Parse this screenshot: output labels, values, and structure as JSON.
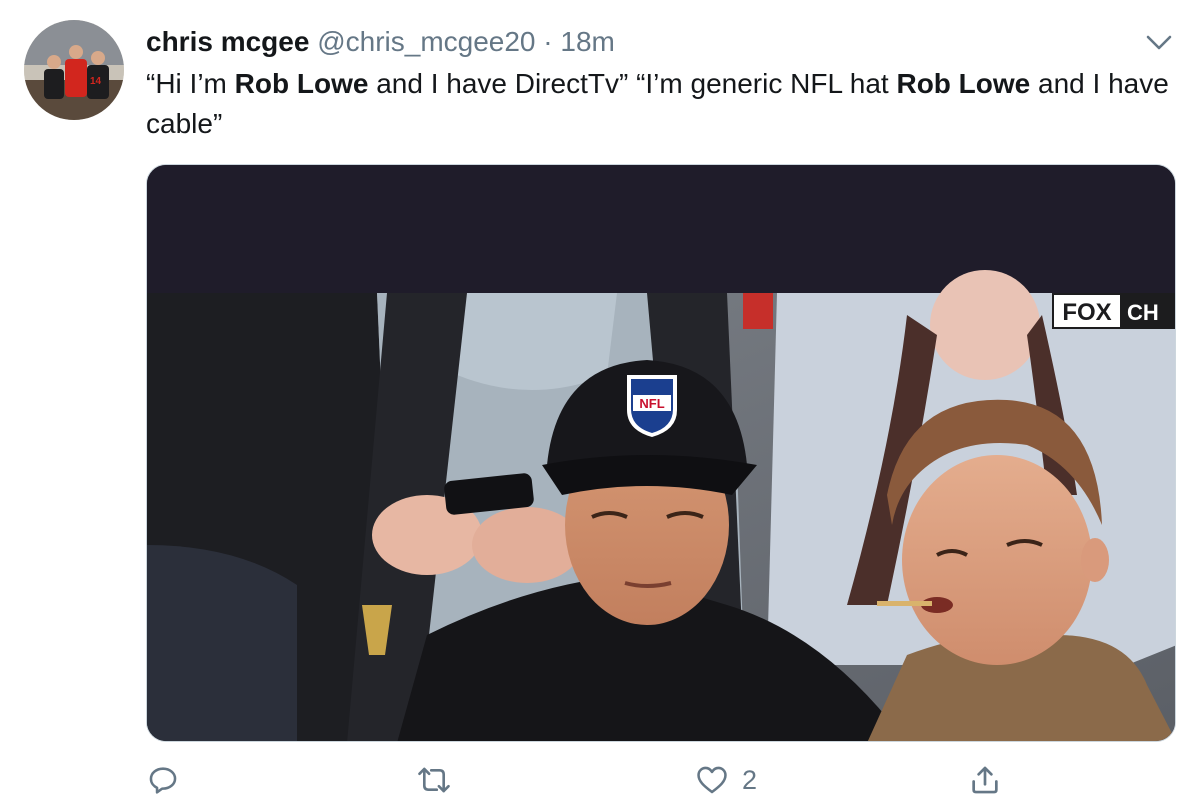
{
  "tweet": {
    "display_name": "chris mcgee",
    "handle": "@chris_mcgee20",
    "separator": "·",
    "time": "18m",
    "text": {
      "p1": "“Hi I’m ",
      "b1": "Rob Lowe",
      "p2": " and I have DirectTv” “I’m generic NFL hat ",
      "b2": "Rob Lowe",
      "p3": " and I have cable”"
    },
    "media": {
      "broadcast_logo": "FOX",
      "broadcast_ticker": "CH",
      "hat_logo_text": "NFL"
    },
    "actions": {
      "like_count": "2"
    }
  },
  "icons": {
    "avatar": "avatar",
    "caret": "chevron-down-icon",
    "reply": "reply-icon",
    "retweet": "retweet-icon",
    "like": "heart-icon",
    "share": "share-icon"
  },
  "colors": {
    "text": "#14171a",
    "muted": "#657786",
    "media_bar": "#1f1c2a"
  }
}
